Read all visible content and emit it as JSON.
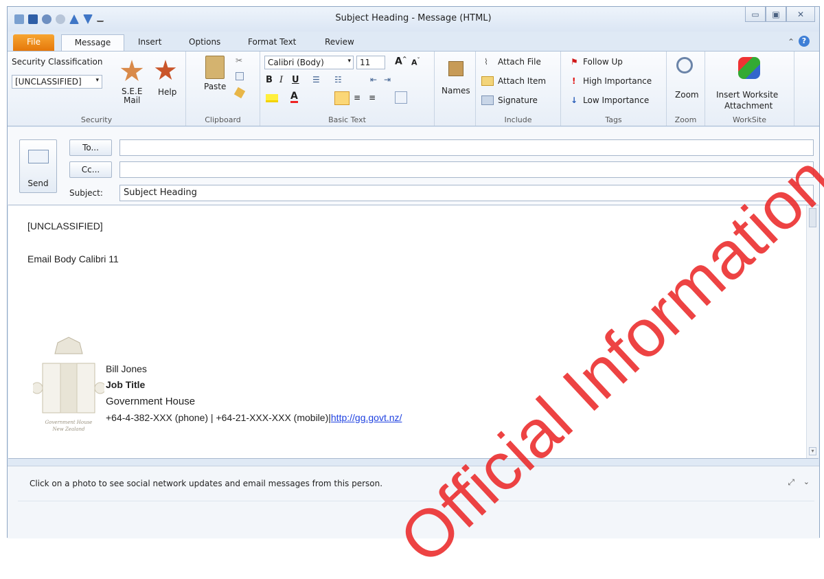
{
  "window": {
    "title": "Subject Heading  - Message (HTML)"
  },
  "tabs": [
    {
      "label": "File"
    },
    {
      "label": "Message"
    },
    {
      "label": "Insert"
    },
    {
      "label": "Options"
    },
    {
      "label": "Format Text"
    },
    {
      "label": "Review"
    }
  ],
  "ribbon": {
    "security": {
      "classification_label": "Security Classification",
      "classification_value": "[UNCLASSIFIED]",
      "see_mail": "S.E.E\nMail",
      "help": "Help",
      "group": "Security"
    },
    "clipboard": {
      "paste": "Paste",
      "group": "Clipboard"
    },
    "basic_text": {
      "font": "Calibri (Body)",
      "size": "11",
      "group": "Basic Text"
    },
    "names": {
      "label": "Names"
    },
    "include": {
      "attach_file": "Attach File",
      "attach_item": "Attach Item",
      "signature": "Signature",
      "group": "Include"
    },
    "tags": {
      "follow_up": "Follow Up",
      "high": "High Importance",
      "low": "Low Importance",
      "group": "Tags"
    },
    "zoom": {
      "label": "Zoom",
      "group": "Zoom"
    },
    "worksite": {
      "label_line1": "Insert Worksite",
      "label_line2": "Attachment",
      "group": "WorkSite"
    }
  },
  "compose": {
    "send": "Send",
    "to_button": "To...",
    "cc_button": "Cc...",
    "subject_label": "Subject:",
    "to_value": "",
    "cc_value": "",
    "subject_value": "Subject Heading"
  },
  "body": {
    "classification": "[UNCLASSIFIED]",
    "line1": "Email Body Calibri 11",
    "signature_name": "Bill Jones",
    "signature_title": "Job Title",
    "signature_org": "Government House",
    "signature_contact": "+64-4-382-XXX (phone) | +64-21-XXX-XXX (mobile)|",
    "signature_url": "http://gg.govt.nz/",
    "logo_text_line1": "Government House",
    "logo_text_line2": "New Zealand"
  },
  "people_pane": {
    "text": "Click on a photo to see social network updates and email messages from this person."
  },
  "watermark": "Official Information Act"
}
